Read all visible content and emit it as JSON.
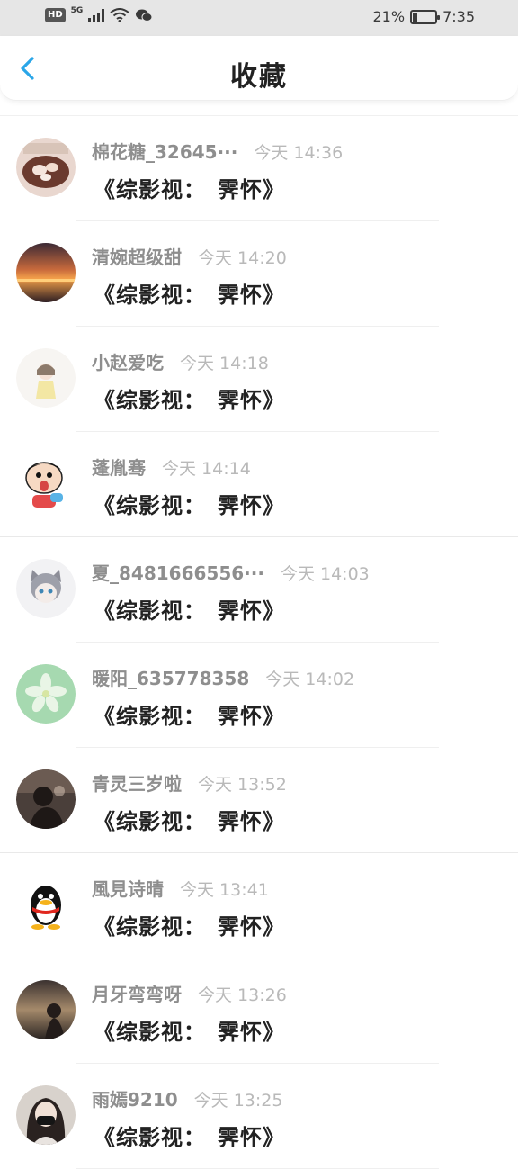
{
  "status_bar": {
    "hd": "HD",
    "network": "5G",
    "battery_text": "21%",
    "battery_level": 0.21,
    "time": "7:35"
  },
  "header": {
    "title": "收藏",
    "back_icon": "chevron-left-icon",
    "accent": "#2aa6e8"
  },
  "items": [
    {
      "user": "棉花糖_32645···",
      "time": "今天 14:36",
      "message": "《综影视：　霁怀》",
      "avatar": "dessert-avatar"
    },
    {
      "user": "清婉超级甜",
      "time": "今天 14:20",
      "message": "《综影视：　霁怀》",
      "avatar": "sunset-avatar"
    },
    {
      "user": "小赵爱吃",
      "time": "今天 14:18",
      "message": "《综影视：　霁怀》",
      "avatar": "girl-drawing-avatar"
    },
    {
      "user": "蓬胤骞",
      "time": "今天 14:14",
      "message": "《综影视：　霁怀》",
      "avatar": "cartoon-boy-avatar"
    },
    {
      "user": "夏_8481666556···",
      "time": "今天 14:03",
      "message": "《综影视：　霁怀》",
      "avatar": "anime-cat-avatar"
    },
    {
      "user": "暖阳_635778358",
      "time": "今天 14:02",
      "message": "《综影视：　霁怀》",
      "avatar": "flower-avatar"
    },
    {
      "user": "青灵三岁啦",
      "time": "今天 13:52",
      "message": "《综影视：　霁怀》",
      "avatar": "silhouette-avatar"
    },
    {
      "user": "風見诗晴",
      "time": "今天 13:41",
      "message": "《综影视：　霁怀》",
      "avatar": "penguin-avatar"
    },
    {
      "user": "月牙弯弯呀",
      "time": "今天 13:26",
      "message": "《综影视：　霁怀》",
      "avatar": "dusk-avatar"
    },
    {
      "user": "雨嫣9210",
      "time": "今天 13:25",
      "message": "《综影视：　霁怀》",
      "avatar": "masked-girl-avatar"
    }
  ]
}
